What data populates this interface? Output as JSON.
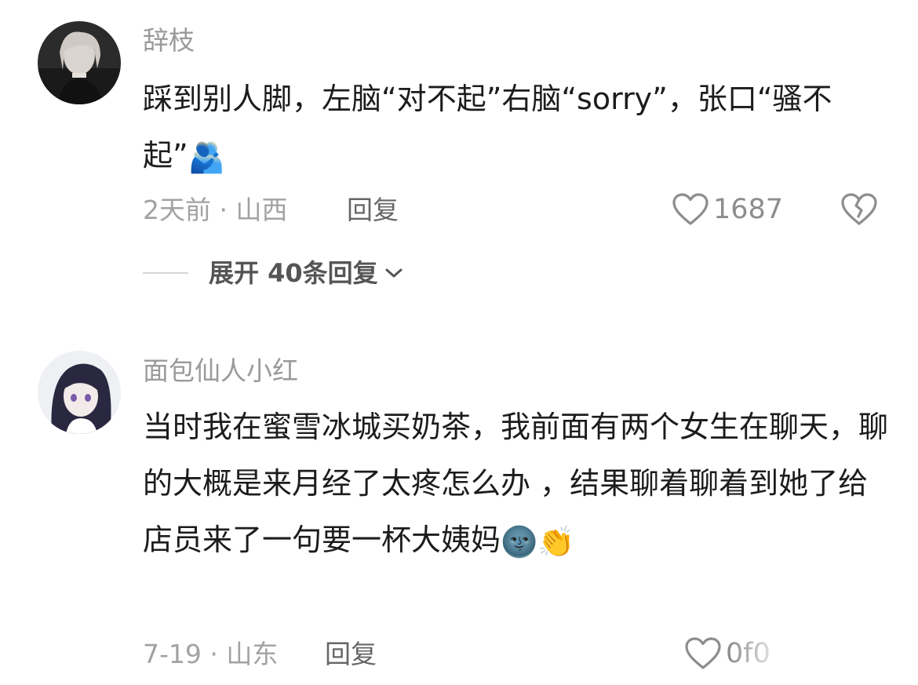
{
  "comments": [
    {
      "username": "辞枝",
      "text": "踩到别人脚，左脑“对不起”右脑“sorry”，张口“骚不起”",
      "emoji": "🫂",
      "time_location": "2天前 · 山西",
      "reply_label": "回复",
      "likes": "1687",
      "expand_label": "展开 40条回复"
    },
    {
      "username": "面包仙人小红",
      "text": "当时我在蜜雪冰城买奶茶，我前面有两个女生在聊天，聊的大概是来月经了太疼怎么办 ，结果聊着聊着到她了给店员来了一句要一杯大姨妈",
      "emoji": "🌚",
      "emoji2": "👏",
      "time_location": "7-19 · 山东",
      "reply_label": "回复",
      "likes": "0f0"
    }
  ],
  "colors": {
    "text_primary": "#1c1c1c",
    "text_secondary": "#9a9a9a",
    "background": "#ffffff"
  },
  "icons": {
    "like": "heart-outline-icon",
    "dislike": "broken-heart-icon",
    "expand": "chevron-down-icon"
  }
}
